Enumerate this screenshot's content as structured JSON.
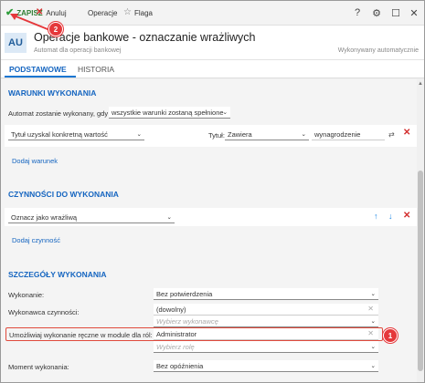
{
  "toolbar": {
    "save_label": "ZAPISZ",
    "cancel_label": "Anuluj",
    "operations_label": "Operacje",
    "flag_label": "Flaga",
    "help_glyph": "?",
    "settings_glyph": "⚙",
    "maximize_glyph": "☐",
    "close_glyph": "✕"
  },
  "header": {
    "avatar": "AU",
    "title": "Operacje bankowe - oznaczanie wrażliwych",
    "subtitle": "Automat dla operacji bankowej",
    "exec_mode": "Wykonywany automatycznie"
  },
  "tabs": [
    {
      "label": "PODSTAWOWE",
      "active": true
    },
    {
      "label": "HISTORIA",
      "active": false
    }
  ],
  "conditions": {
    "section_title": "WARUNKI WYKONANIA",
    "run_when_label": "Automat zostanie wykonany, gdy",
    "run_when_value": "wszystkie warunki zostaną spełnione",
    "condition_type": "Tytuł uzyskal konkretną wartość",
    "field_label": "Tytuł:",
    "operator": "Zawiera",
    "value": "wynagrodzenie",
    "add_link": "Dodaj warunek"
  },
  "actions": {
    "section_title": "CZYNNOŚCI DO WYKONANIA",
    "action_value": "Oznacz jako wrażliwą",
    "add_link": "Dodaj czynność"
  },
  "details": {
    "section_title": "SZCZEGÓŁY WYKONANIA",
    "execution_label": "Wykonanie:",
    "execution_value": "Bez potwierdzenia",
    "performer_label": "Wykonawca czynności:",
    "performer_value": "(dowolny)",
    "performer_placeholder": "Wybierz wykonawcę",
    "manual_label": "Umożliwiaj wykonanie ręczne w module dla ról:",
    "manual_value": "Administrator",
    "role_placeholder": "Wybierz rolę",
    "moment_label": "Moment wykonania:",
    "moment_value": "Bez opóźnienia"
  },
  "annotations": {
    "badge_1": "1",
    "badge_2": "2"
  },
  "colors": {
    "accent": "#1565c0",
    "save_green": "#2e9d3a",
    "delete_red": "#d32f2f",
    "annotation_red": "#e5383b"
  },
  "icons": [
    "checkmark-icon",
    "cancel-x-icon",
    "star-icon",
    "help-icon",
    "gear-icon",
    "maximize-icon",
    "close-icon",
    "chevron-down-icon",
    "swap-icon",
    "delete-icon",
    "arrow-up-icon",
    "arrow-down-icon"
  ]
}
